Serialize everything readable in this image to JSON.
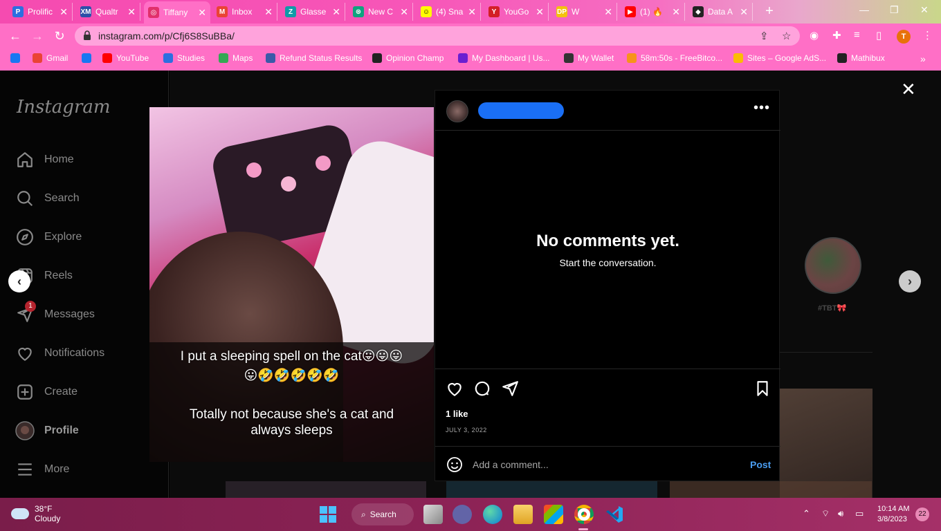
{
  "browser": {
    "tabs": [
      {
        "label": "Prolific",
        "color": "#2c6fe0",
        "glyph": "P"
      },
      {
        "label": "Qualtr",
        "color": "#2b4fa8",
        "glyph": "XM"
      },
      {
        "label": "Tiffany",
        "color": "#e1306c",
        "glyph": "◎",
        "active": true
      },
      {
        "label": "Inbox",
        "color": "#ea4335",
        "glyph": "M"
      },
      {
        "label": "Glasse",
        "color": "#0f9aa8",
        "glyph": "Z"
      },
      {
        "label": "New C",
        "color": "#10a37f",
        "glyph": "⊛"
      },
      {
        "label": "(4) Sna",
        "color": "#fffc00",
        "glyph": "☺"
      },
      {
        "label": "YouGo",
        "color": "#d31f26",
        "glyph": "Y"
      },
      {
        "label": "W",
        "color": "#f4c20d",
        "glyph": "DP"
      },
      {
        "label": "(1) 🔥",
        "color": "#ff0000",
        "glyph": "▶"
      },
      {
        "label": "Data A",
        "color": "#222222",
        "glyph": "◆"
      }
    ],
    "url": "instagram.com/p/Cfj6S8SuBBa/",
    "profile_initial": "T",
    "bookmarks": [
      {
        "label": "",
        "color": "#1877f2"
      },
      {
        "label": "Gmail",
        "color": "#ea4335"
      },
      {
        "label": "",
        "color": "#1877f2"
      },
      {
        "label": "YouTube",
        "color": "#ff0000"
      },
      {
        "label": "Studies",
        "color": "#2c6fe0"
      },
      {
        "label": "Maps",
        "color": "#34a853"
      },
      {
        "label": "Refund Status Results",
        "color": "#3a5aa8"
      },
      {
        "label": "Opinion Champ",
        "color": "#222222"
      },
      {
        "label": "My Dashboard | Us...",
        "color": "#6a1fd1"
      },
      {
        "label": "My Wallet",
        "color": "#333333"
      },
      {
        "label": "58m:50s - FreeBitco...",
        "color": "#f7931a"
      },
      {
        "label": "Sites – Google AdS...",
        "color": "#fbbc04"
      },
      {
        "label": "Mathibux",
        "color": "#222222"
      }
    ],
    "bookmarks_more": "»"
  },
  "sidebar": {
    "logo": "Instagram",
    "items": [
      {
        "label": "Home",
        "icon": "home-icon"
      },
      {
        "label": "Search",
        "icon": "search-icon"
      },
      {
        "label": "Explore",
        "icon": "compass-icon"
      },
      {
        "label": "Reels",
        "icon": "reels-icon"
      },
      {
        "label": "Messages",
        "icon": "messenger-icon",
        "badge": "1"
      },
      {
        "label": "Notifications",
        "icon": "heart-icon"
      },
      {
        "label": "Create",
        "icon": "plus-square-icon"
      },
      {
        "label": "Profile",
        "icon": "avatar"
      },
      {
        "label": "More",
        "icon": "menu-icon"
      }
    ]
  },
  "post": {
    "caption_line1": "I put a sleeping spell on the cat😛😛😛",
    "caption_line2": "😛🤣🤣🤣🤣🤣",
    "caption_line3": "Totally not because she's a cat and",
    "caption_line4": "always sleeps",
    "no_comments_title": "No comments yet.",
    "no_comments_sub": "Start the conversation.",
    "likes": "1 like",
    "date": "JULY 3, 2022",
    "comment_placeholder": "Add a comment...",
    "post_label": "Post",
    "more": "•••"
  },
  "background": {
    "story_label": "#TBT🎀"
  },
  "taskbar": {
    "temp": "38°F",
    "condition": "Cloudy",
    "search_label": "Search",
    "time": "10:14 AM",
    "date": "3/8/2023",
    "notifications": "22"
  }
}
